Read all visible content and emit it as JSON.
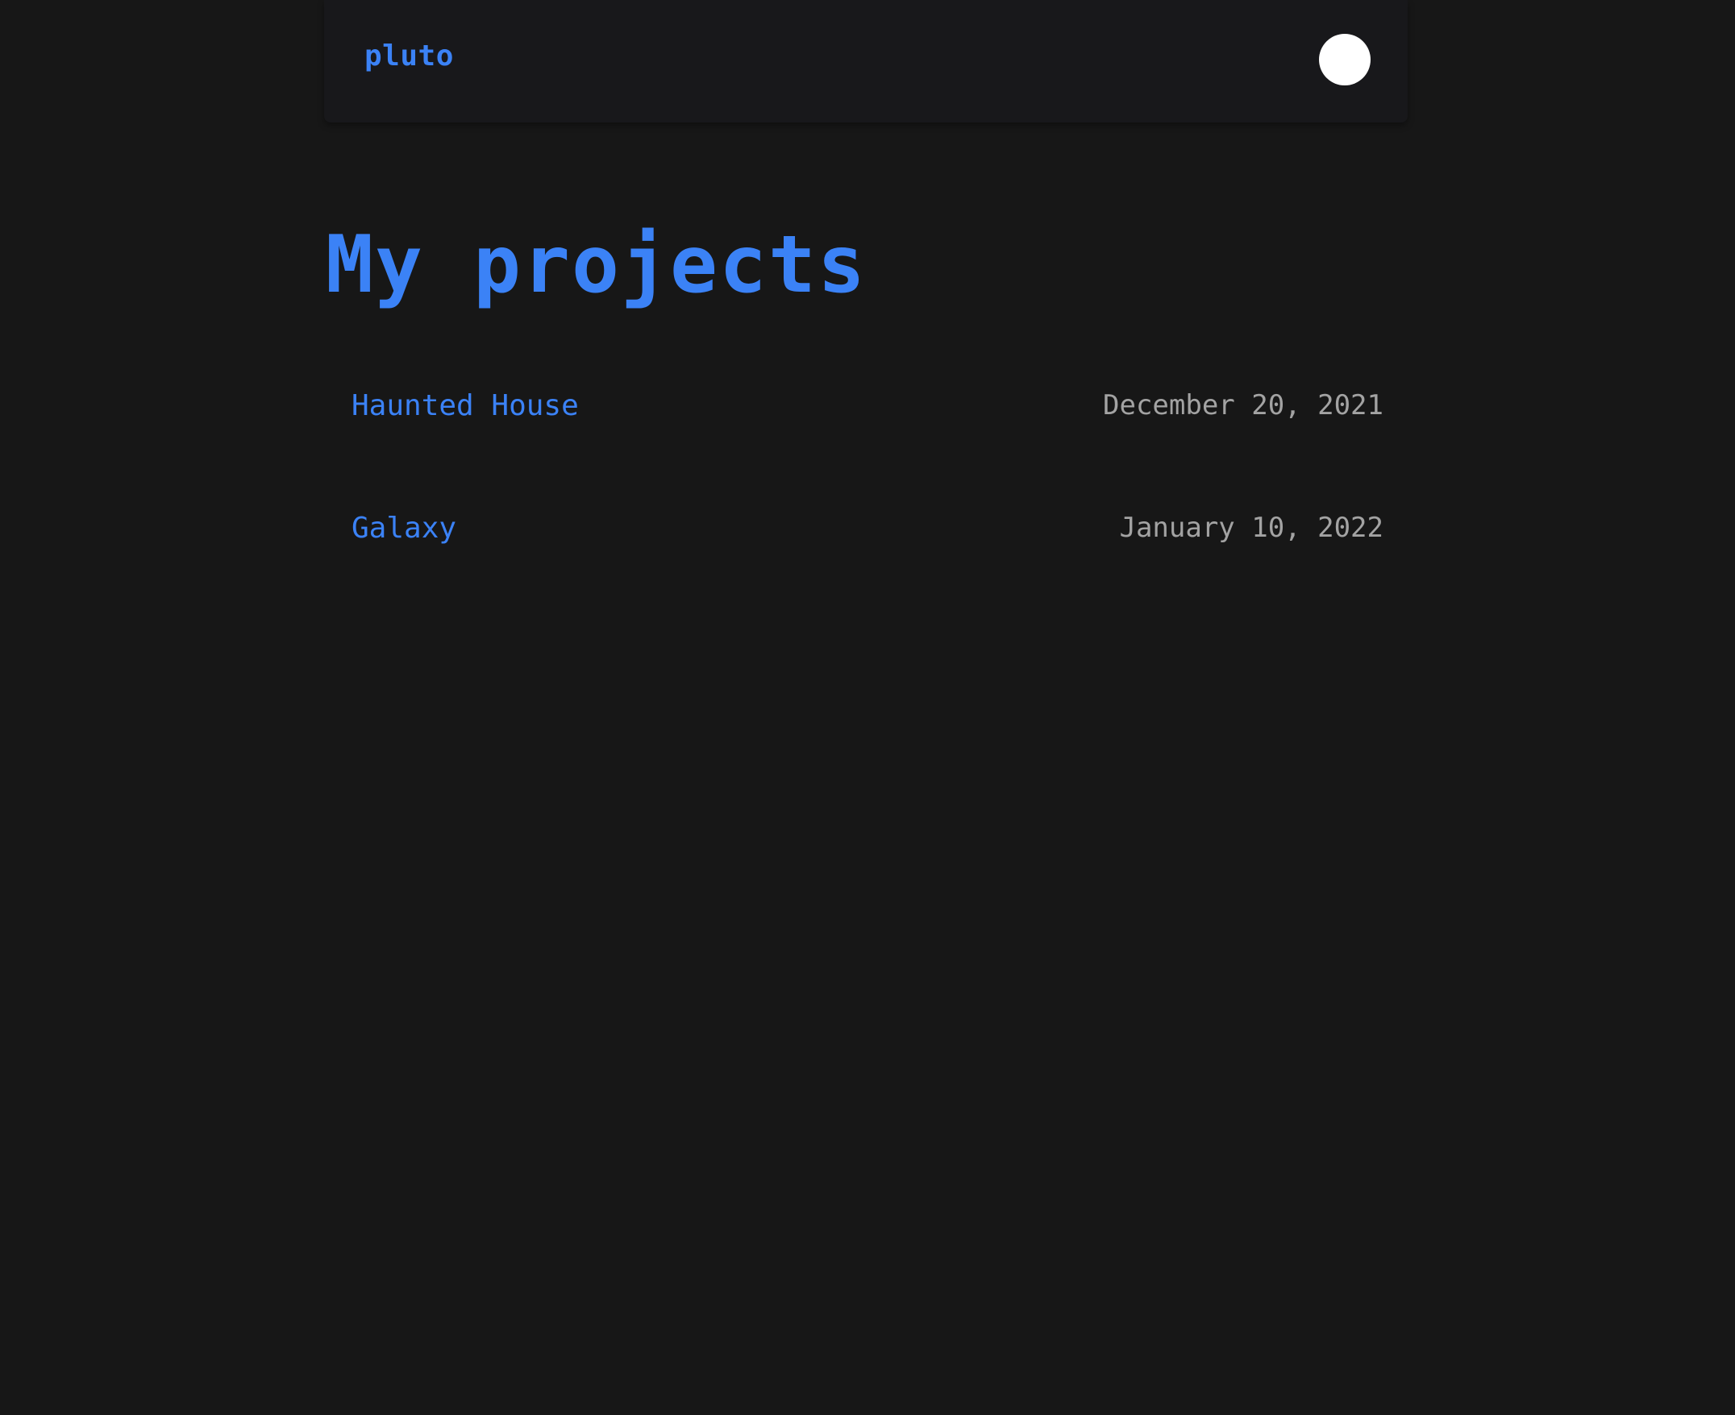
{
  "header": {
    "logo": "pluto",
    "theme_toggle": "theme-toggle"
  },
  "main": {
    "title": "My projects",
    "projects": [
      {
        "name": "Haunted House",
        "date": "December 20, 2021"
      },
      {
        "name": "Galaxy",
        "date": "January 10, 2022"
      }
    ]
  },
  "colors": {
    "background": "#171717",
    "header_background": "#18181b",
    "accent": "#3b82f6",
    "muted_text": "#a3a3a3",
    "toggle": "#ffffff"
  }
}
